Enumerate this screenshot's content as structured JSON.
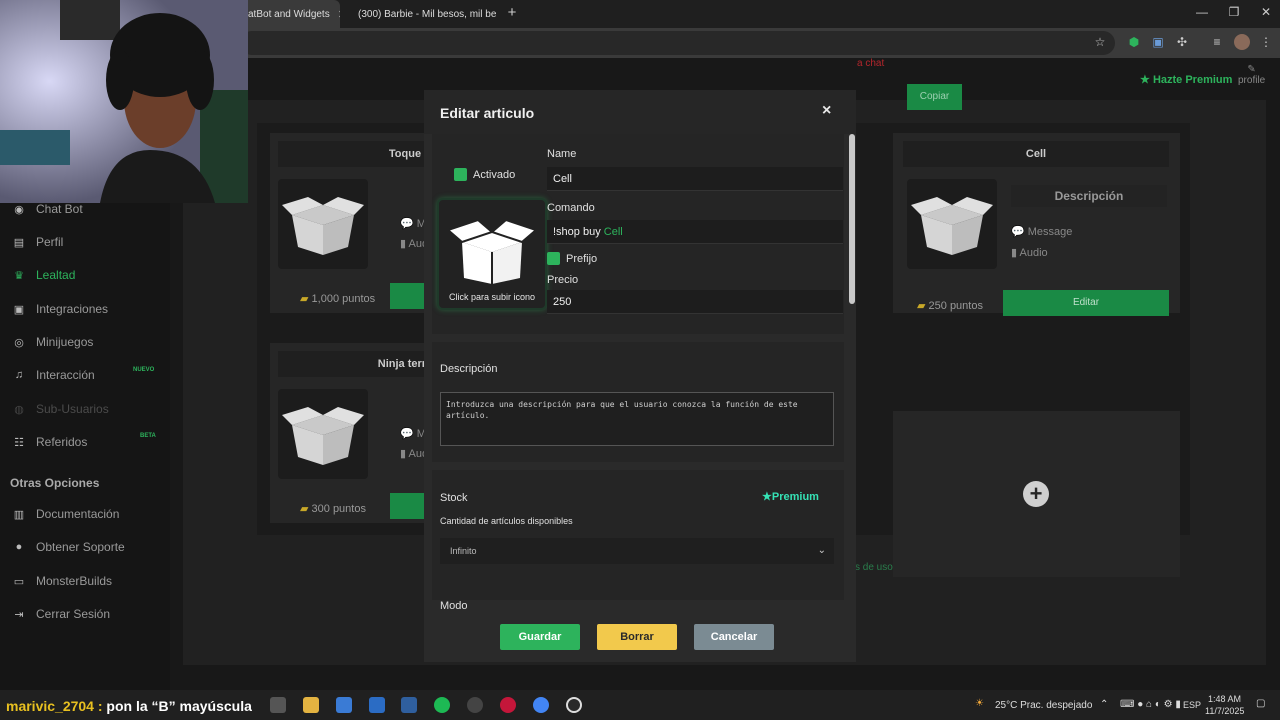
{
  "browser": {
    "tab1_title": "atBot and Widgets",
    "tab2_title": "(300) Barbie - Mil besos, mil be",
    "tab_close": "✕",
    "newtab": "+"
  },
  "app": {
    "premium_cta": "Hazte Premium",
    "profile_label": "profile",
    "red_note": "a chat",
    "copy_label": "Copiar",
    "terms_note": "s de uso.",
    "sidebar": {
      "items": [
        {
          "label": "Chat Bot"
        },
        {
          "label": "Perfil"
        },
        {
          "label": "Lealtad"
        },
        {
          "label": "Integraciones"
        },
        {
          "label": "Minijuegos"
        },
        {
          "label": "Interacción"
        },
        {
          "label": "Sub-Usuarios"
        },
        {
          "label": "Referidos"
        }
      ],
      "badge_new": "NUEVO",
      "badge_beta": "BETA",
      "section": "Otras Opciones",
      "other": [
        {
          "label": "Documentación"
        },
        {
          "label": "Obtener Soporte"
        },
        {
          "label": "MonsterBuilds"
        },
        {
          "label": "Cerrar Sesión"
        }
      ]
    },
    "cards": [
      {
        "title": "Toque",
        "points": "1,000 puntos",
        "meta1": "Me",
        "meta2": "Aud"
      },
      {
        "title": "Cell",
        "points": "250 puntos",
        "description": "Descripción",
        "meta1": "Message",
        "meta2": "Audio",
        "button": "Editar"
      },
      {
        "title": "Ninja terre",
        "points": "300 puntos",
        "meta1": "Me",
        "meta2": "Aud"
      }
    ],
    "add_symbol": "+"
  },
  "modal": {
    "title": "Editar articulo",
    "close": "×",
    "activado": "Activado",
    "name_label": "Name",
    "name_value": "Cell",
    "comando_label": "Comando",
    "comando_prefix": "!shop buy",
    "comando_item": "Cell",
    "prefijo": "Prefijo",
    "precio_label": "Precio",
    "precio_value": "250",
    "upload_caption": "Click para subir icono",
    "descripcion_label": "Descripción",
    "descripcion_placeholder": "Introduzca una descripción para que el usuario conozca la función de este artículo.",
    "stock_label": "Stock",
    "premium_label": "Premium",
    "stock_sub": "Cantidad de artículos disponibles",
    "stock_value": "Infinito",
    "modo_label": "Modo",
    "guardar": "Guardar",
    "borrar": "Borrar",
    "cancelar": "Cancelar"
  },
  "taskbar": {
    "overlay_user": "marivic_2704 :",
    "overlay_msg": " pon la “B” mayúscula",
    "weather": "25°C  Prac. despejado",
    "lang": "ESP",
    "time": "1:48 AM",
    "date": "11/7/2025"
  },
  "colors": {
    "accent_green": "#2db35c",
    "premium_teal": "#35e2b5",
    "borrar_yellow": "#f2c94c",
    "cancelar_gray": "#7b8b93"
  }
}
